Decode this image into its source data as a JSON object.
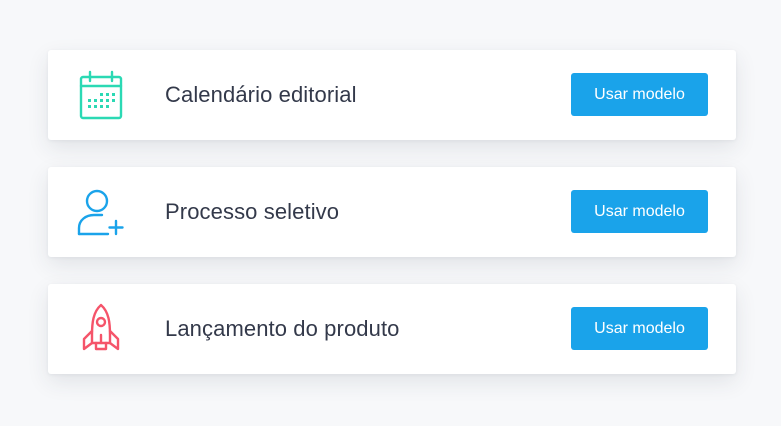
{
  "templates": [
    {
      "title": "Calendário editorial",
      "button_label": "Usar modelo",
      "icon": "calendar-icon",
      "icon_color": "#2bd9b4"
    },
    {
      "title": "Processo seletivo",
      "button_label": "Usar modelo",
      "icon": "add-user-icon",
      "icon_color": "#1aa3ea"
    },
    {
      "title": "Lançamento do produto",
      "button_label": "Usar modelo",
      "icon": "rocket-icon",
      "icon_color": "#f5546a"
    }
  ],
  "colors": {
    "background": "#f7f8fa",
    "card": "#ffffff",
    "text": "#33394a",
    "button": "#1aa3ea",
    "button_text": "#ffffff"
  }
}
